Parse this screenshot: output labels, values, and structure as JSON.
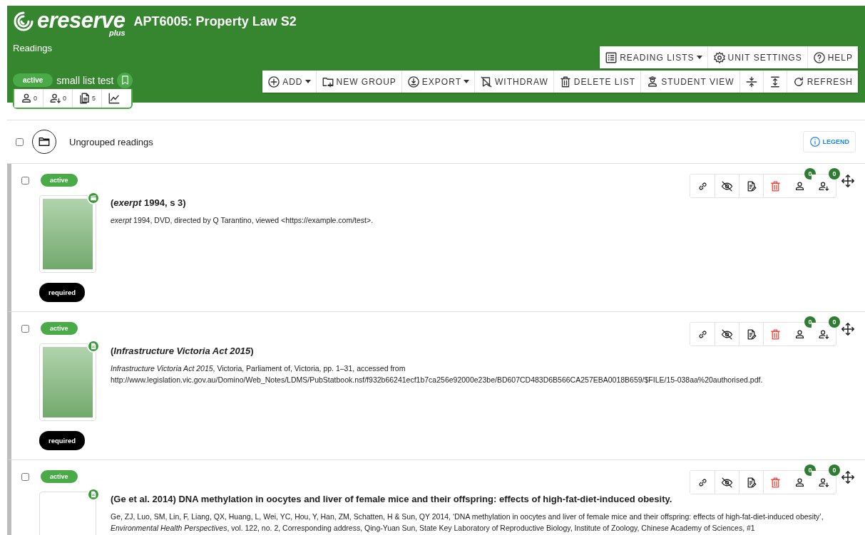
{
  "header": {
    "logo": "ereserve",
    "logo_sub": "plus",
    "title": "APT6005: Property Law S2",
    "section": "Readings"
  },
  "list": {
    "status": "active",
    "name": "small list test",
    "stats": [
      {
        "kind": "students",
        "count": "0"
      },
      {
        "kind": "downloads",
        "count": "0"
      },
      {
        "kind": "readings",
        "count": "5"
      },
      {
        "kind": "chart"
      }
    ]
  },
  "top_buttons": [
    {
      "kind": "list",
      "label": "READING LISTS",
      "dropdown": true
    },
    {
      "kind": "gear",
      "label": "UNIT SETTINGS",
      "dropdown": false
    },
    {
      "kind": "help",
      "label": "HELP",
      "dropdown": false
    }
  ],
  "toolbar": [
    {
      "kind": "add",
      "label": "ADD",
      "dropdown": true
    },
    {
      "kind": "new-group",
      "label": "NEW GROUP",
      "dropdown": false
    },
    {
      "kind": "export",
      "label": "EXPORT",
      "dropdown": true
    },
    {
      "kind": "withdraw",
      "label": "WITHDRAW",
      "dropdown": false
    },
    {
      "kind": "trash",
      "label": "DELETE LIST",
      "dropdown": false
    },
    {
      "kind": "student",
      "label": "STUDENT VIEW",
      "dropdown": false
    },
    {
      "kind": "collapse",
      "dropdown": false
    },
    {
      "kind": "expand",
      "dropdown": false
    },
    {
      "kind": "refresh",
      "label": "REFRESH",
      "dropdown": false
    }
  ],
  "group": {
    "title": "Ungrouped readings",
    "checked": false,
    "legend": "LEGEND"
  },
  "readings": [
    {
      "checked": false,
      "status": "active",
      "kind": "video",
      "has_cover": true,
      "title": "(*exerpt* 1994, s 3)",
      "citation": "*exerpt* 1994, DVD, directed by Q Tarantino, viewed <https://example.com/test>.",
      "requirement": "required",
      "views": "0",
      "downloads": "0"
    },
    {
      "checked": false,
      "status": "active",
      "kind": "document",
      "has_cover": true,
      "title": "(*Infrastructure Victoria Act 2015*)",
      "citation": "*Infrastructure Victoria Act 2015*, Victoria, Parliament of, Victoria, pp. 1–31, accessed from http://www.legislation.vic.gov.au/Domino/Web_Notes/LDMS/PubStatbook.nsf/f932b66241ecf1b7ca256e92000e23be/BD607CD483D6B566CA257EBA0018B659/$FILE/15-038aa%20authorised.pdf.",
      "requirement": "required",
      "views": "0",
      "downloads": "0"
    },
    {
      "checked": false,
      "status": "active",
      "kind": "document",
      "has_cover": false,
      "title": "(Ge et al. 2014) DNA methylation in oocytes and liver of female mice and their offspring: effects of high-fat-diet-induced obesity.",
      "citation": "Ge, ZJ, Luo, SM, Lin, F, Liang, QX, Huang, L, Wei, YC, Hou, Y, Han, ZM, Schatten, H & Sun, QY 2014, ‘DNA methylation in oocytes and liver of female mice and their offspring: effects of high-fat-diet-induced obesity’, *Environmental Health Perspectives*, vol. 122, no. 2, Corresponding address, Qing-Yuan Sun, State Key Laboratory of Reproductive Biology, Institute of Zoology, Chinese Academy of Sciences, #1",
      "views": "0",
      "downloads": "0"
    }
  ]
}
